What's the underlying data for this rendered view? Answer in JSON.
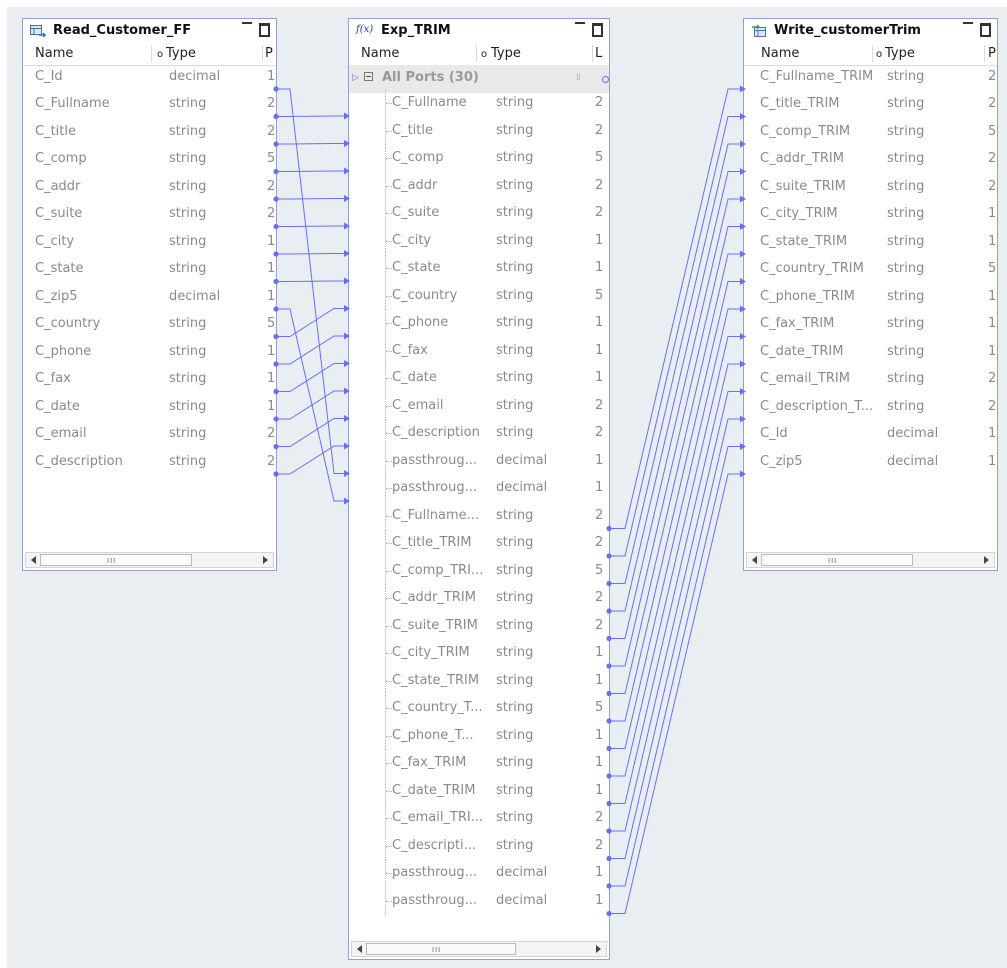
{
  "colors": {
    "canvas_bg": "#e9eef3",
    "panel_border": "#8fa3c2",
    "link": "#6b6ef5"
  },
  "columns": {
    "name": "Name",
    "type": "Type",
    "precision_trunc": "P",
    "length_trunc": "L"
  },
  "scroll_grip": "III",
  "read": {
    "title": "Read_Customer_FF",
    "icon": "read-source-icon",
    "rows": [
      {
        "name": "C_Id",
        "type": "decimal",
        "prec": "1"
      },
      {
        "name": "C_Fullname",
        "type": "string",
        "prec": "2"
      },
      {
        "name": "C_title",
        "type": "string",
        "prec": "2"
      },
      {
        "name": "C_comp",
        "type": "string",
        "prec": "5"
      },
      {
        "name": "C_addr",
        "type": "string",
        "prec": "2"
      },
      {
        "name": "C_suite",
        "type": "string",
        "prec": "2"
      },
      {
        "name": "C_city",
        "type": "string",
        "prec": "1"
      },
      {
        "name": "C_state",
        "type": "string",
        "prec": "1"
      },
      {
        "name": "C_zip5",
        "type": "decimal",
        "prec": "1"
      },
      {
        "name": "C_country",
        "type": "string",
        "prec": "5"
      },
      {
        "name": "C_phone",
        "type": "string",
        "prec": "1"
      },
      {
        "name": "C_fax",
        "type": "string",
        "prec": "1"
      },
      {
        "name": "C_date",
        "type": "string",
        "prec": "1"
      },
      {
        "name": "C_email",
        "type": "string",
        "prec": "2"
      },
      {
        "name": "C_description",
        "type": "string",
        "prec": "2"
      }
    ]
  },
  "exp": {
    "title": "Exp_TRIM",
    "icon": "fx-expression-icon",
    "icon_text": "f(x)",
    "all_ports": "All Ports (30)",
    "rows": [
      {
        "name": "C_Fullname",
        "type": "string",
        "prec": "2"
      },
      {
        "name": "C_title",
        "type": "string",
        "prec": "2"
      },
      {
        "name": "C_comp",
        "type": "string",
        "prec": "5"
      },
      {
        "name": "C_addr",
        "type": "string",
        "prec": "2"
      },
      {
        "name": "C_suite",
        "type": "string",
        "prec": "2"
      },
      {
        "name": "C_city",
        "type": "string",
        "prec": "1"
      },
      {
        "name": "C_state",
        "type": "string",
        "prec": "1"
      },
      {
        "name": "C_country",
        "type": "string",
        "prec": "5"
      },
      {
        "name": "C_phone",
        "type": "string",
        "prec": "1"
      },
      {
        "name": "C_fax",
        "type": "string",
        "prec": "1"
      },
      {
        "name": "C_date",
        "type": "string",
        "prec": "1"
      },
      {
        "name": "C_email",
        "type": "string",
        "prec": "2"
      },
      {
        "name": "C_description",
        "type": "string",
        "prec": "2"
      },
      {
        "name": "passthroug...",
        "type": "decimal",
        "prec": "1"
      },
      {
        "name": "passthroug...",
        "type": "decimal",
        "prec": "1"
      },
      {
        "name": "C_Fullname...",
        "type": "string",
        "prec": "2"
      },
      {
        "name": "C_title_TRIM",
        "type": "string",
        "prec": "2"
      },
      {
        "name": "C_comp_TRI...",
        "type": "string",
        "prec": "5"
      },
      {
        "name": "C_addr_TRIM",
        "type": "string",
        "prec": "2"
      },
      {
        "name": "C_suite_TRIM",
        "type": "string",
        "prec": "2"
      },
      {
        "name": "C_city_TRIM",
        "type": "string",
        "prec": "1"
      },
      {
        "name": "C_state_TRIM",
        "type": "string",
        "prec": "1"
      },
      {
        "name": "C_country_T...",
        "type": "string",
        "prec": "5"
      },
      {
        "name": "C_phone_T...",
        "type": "string",
        "prec": "1"
      },
      {
        "name": "C_fax_TRIM",
        "type": "string",
        "prec": "1"
      },
      {
        "name": "C_date_TRIM",
        "type": "string",
        "prec": "1"
      },
      {
        "name": "C_email_TRI...",
        "type": "string",
        "prec": "2"
      },
      {
        "name": "C_descripti...",
        "type": "string",
        "prec": "2"
      },
      {
        "name": "passthroug...",
        "type": "decimal",
        "prec": "1"
      },
      {
        "name": "passthroug...",
        "type": "decimal",
        "prec": "1"
      }
    ]
  },
  "write": {
    "title": "Write_customerTrim",
    "icon": "write-target-icon",
    "rows": [
      {
        "name": "C_Fullname_TRIM",
        "type": "string",
        "prec": "2"
      },
      {
        "name": "C_title_TRIM",
        "type": "string",
        "prec": "2"
      },
      {
        "name": "C_comp_TRIM",
        "type": "string",
        "prec": "5"
      },
      {
        "name": "C_addr_TRIM",
        "type": "string",
        "prec": "2"
      },
      {
        "name": "C_suite_TRIM",
        "type": "string",
        "prec": "2"
      },
      {
        "name": "C_city_TRIM",
        "type": "string",
        "prec": "1"
      },
      {
        "name": "C_state_TRIM",
        "type": "string",
        "prec": "1"
      },
      {
        "name": "C_country_TRIM",
        "type": "string",
        "prec": "5"
      },
      {
        "name": "C_phone_TRIM",
        "type": "string",
        "prec": "1"
      },
      {
        "name": "C_fax_TRIM",
        "type": "string",
        "prec": "1"
      },
      {
        "name": "C_date_TRIM",
        "type": "string",
        "prec": "1"
      },
      {
        "name": "C_email_TRIM",
        "type": "string",
        "prec": "2"
      },
      {
        "name": "C_description_T...",
        "type": "string",
        "prec": "2"
      },
      {
        "name": "C_Id",
        "type": "decimal",
        "prec": "1"
      },
      {
        "name": "C_zip5",
        "type": "decimal",
        "prec": "1"
      }
    ]
  },
  "links_read_to_exp": [
    [
      1,
      0
    ],
    [
      2,
      1
    ],
    [
      3,
      2
    ],
    [
      4,
      3
    ],
    [
      5,
      4
    ],
    [
      6,
      5
    ],
    [
      7,
      6
    ],
    [
      9,
      7
    ],
    [
      10,
      8
    ],
    [
      11,
      9
    ],
    [
      12,
      10
    ],
    [
      13,
      11
    ],
    [
      14,
      12
    ],
    [
      0,
      13
    ],
    [
      8,
      14
    ]
  ],
  "links_exp_to_write": [
    [
      15,
      0
    ],
    [
      16,
      1
    ],
    [
      17,
      2
    ],
    [
      18,
      3
    ],
    [
      19,
      4
    ],
    [
      20,
      5
    ],
    [
      21,
      6
    ],
    [
      22,
      7
    ],
    [
      23,
      8
    ],
    [
      24,
      9
    ],
    [
      25,
      10
    ],
    [
      26,
      11
    ],
    [
      27,
      12
    ],
    [
      28,
      13
    ],
    [
      29,
      14
    ]
  ]
}
